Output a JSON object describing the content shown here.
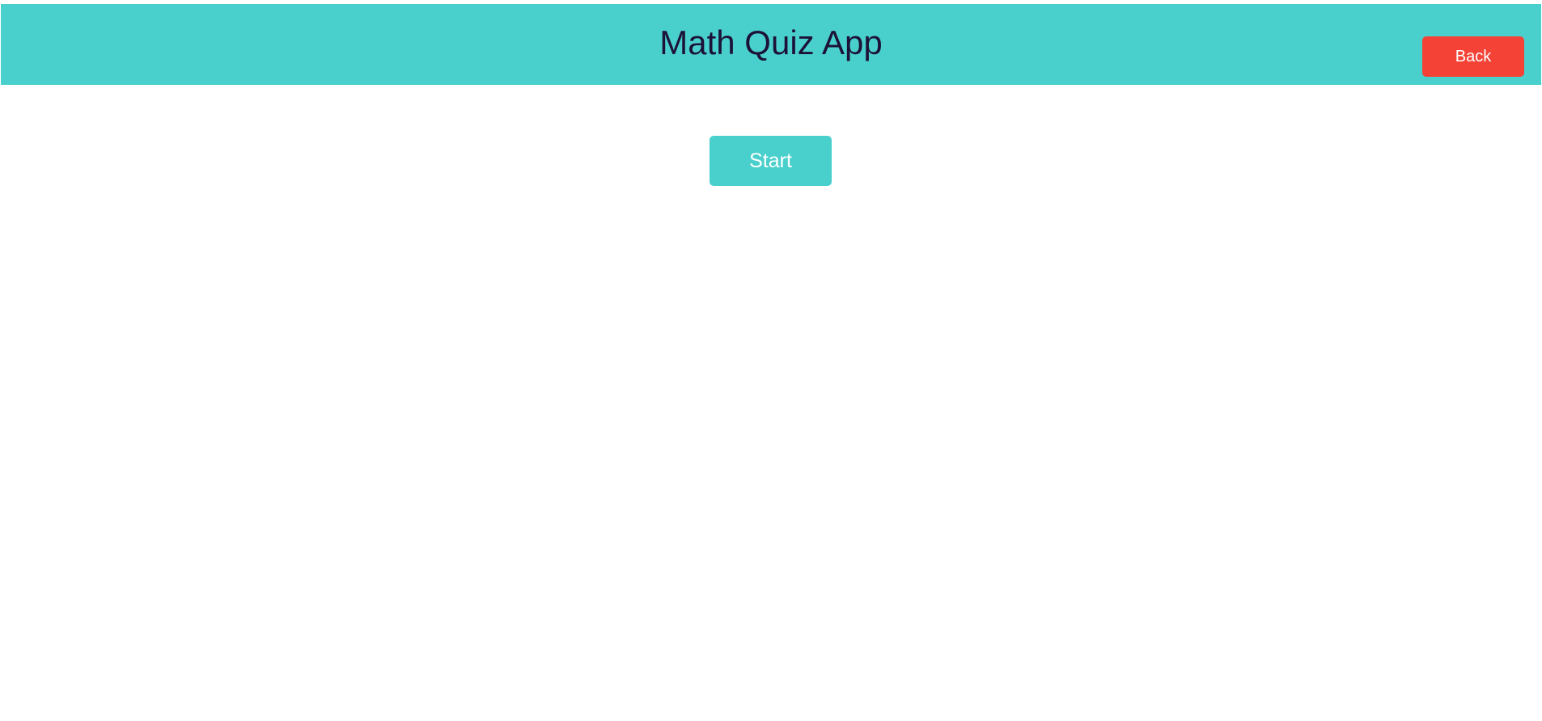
{
  "header": {
    "title": "Math Quiz App",
    "back_label": "Back"
  },
  "main": {
    "start_label": "Start"
  },
  "colors": {
    "header_bg": "#4ad0cc",
    "title_text": "#1c1238",
    "back_button_bg": "#f44336",
    "start_button_bg": "#4ad0cc",
    "button_text": "#ffffff"
  }
}
